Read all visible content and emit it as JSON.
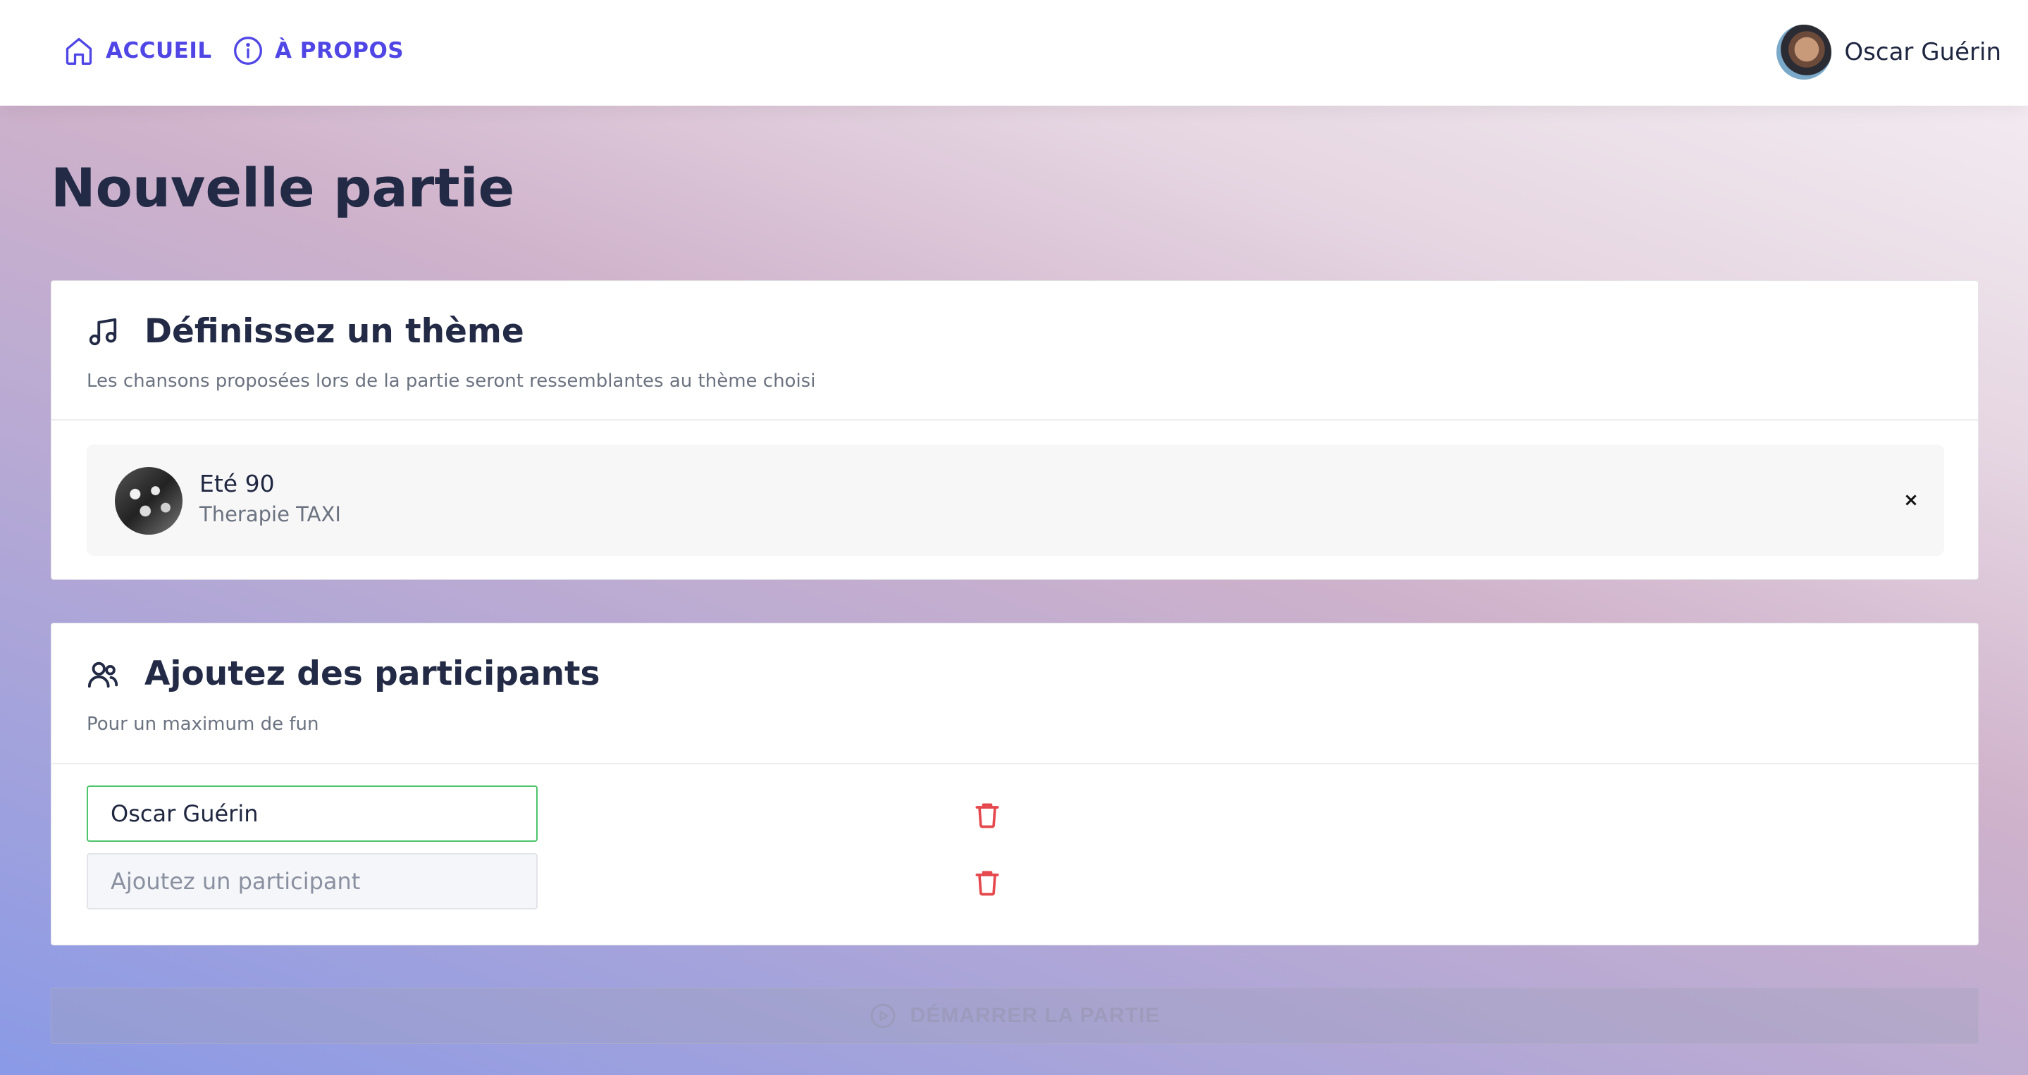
{
  "nav": {
    "home_label": "ACCUEIL",
    "about_label": "À PROPOS",
    "user_name": "Oscar Guérin"
  },
  "page": {
    "title": "Nouvelle partie"
  },
  "theme_section": {
    "title": "Définissez un thème",
    "subtitle": "Les chansons proposées lors de la partie seront ressemblantes au thème choisi",
    "selected": {
      "name": "Eté 90",
      "artist": "Therapie TAXI",
      "remove_symbol": "×"
    }
  },
  "players_section": {
    "title": "Ajoutez des participants",
    "subtitle": "Pour un maximum de fun",
    "players": [
      {
        "value": "Oscar Guérin",
        "placeholder": ""
      },
      {
        "value": "",
        "placeholder": "Ajoutez un participant"
      }
    ]
  },
  "start_button": {
    "label": "DÉMARRER LA PARTIE",
    "enabled": false
  },
  "colors": {
    "accent": "#4f46e5",
    "danger": "#e5484d",
    "success_border": "#4cc46a",
    "title": "#222a45"
  },
  "icons": {
    "home": "home-icon",
    "about": "info-icon",
    "theme": "music-note-icon",
    "players": "users-icon",
    "delete": "trash-icon",
    "start": "play-circle-icon"
  }
}
